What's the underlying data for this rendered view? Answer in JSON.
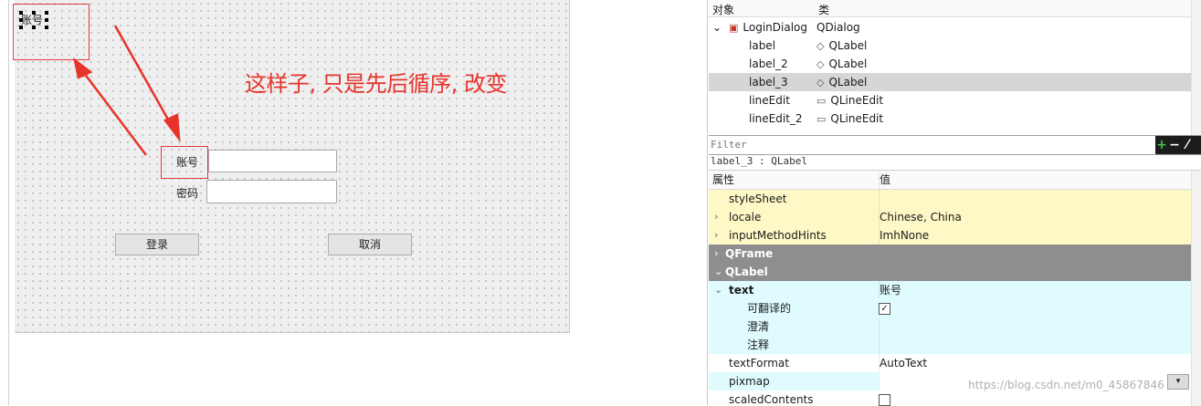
{
  "designer": {
    "selected_widget_text": "账号",
    "annotation": "这样子, 只是先后循序, 改变",
    "form": {
      "account_label": "账号",
      "password_label": "密码",
      "account_value": "",
      "password_value": "",
      "login_button": "登录",
      "cancel_button": "取消"
    }
  },
  "object_inspector": {
    "headers": {
      "object": "对象",
      "class": "类"
    },
    "items": [
      {
        "name": "LoginDialog",
        "class": "QDialog",
        "icon": "dialog-icon",
        "expanded": true
      },
      {
        "name": "label",
        "class": "QLabel",
        "icon": "label-icon"
      },
      {
        "name": "label_2",
        "class": "QLabel",
        "icon": "label-icon"
      },
      {
        "name": "label_3",
        "class": "QLabel",
        "icon": "label-icon",
        "selected": true
      },
      {
        "name": "lineEdit",
        "class": "QLineEdit",
        "icon": "lineedit-icon"
      },
      {
        "name": "lineEdit_2",
        "class": "QLineEdit",
        "icon": "lineedit-icon"
      }
    ]
  },
  "property_editor": {
    "filter_placeholder": "Filter",
    "add_symbol": "+",
    "remove_symbol": "−",
    "current_object": "label_3 : QLabel",
    "headers": {
      "property": "属性",
      "value": "值"
    },
    "rows": [
      {
        "key": "styleSheet",
        "value": ""
      },
      {
        "key": "locale",
        "value": "Chinese, China"
      },
      {
        "key": "inputMethodHints",
        "value": "ImhNone"
      },
      {
        "key": "QFrame",
        "value": ""
      },
      {
        "key": "QLabel",
        "value": ""
      },
      {
        "key": "text",
        "value": "账号"
      },
      {
        "key": "可翻译的",
        "value": "✓"
      },
      {
        "key": "澄清",
        "value": ""
      },
      {
        "key": "注释",
        "value": ""
      },
      {
        "key": "textFormat",
        "value": "AutoText"
      },
      {
        "key": "pixmap",
        "value": ""
      },
      {
        "key": "scaledContents",
        "value": ""
      }
    ]
  },
  "watermark": "https://blog.csdn.net/m0_45867846",
  "colors": {
    "annotation_red": "#e8332c",
    "row_yellow": "#fdf8c6",
    "row_cyan": "#dffbfd",
    "section_gray": "#8e8e8e",
    "selection_gray": "#d6d6d6"
  }
}
